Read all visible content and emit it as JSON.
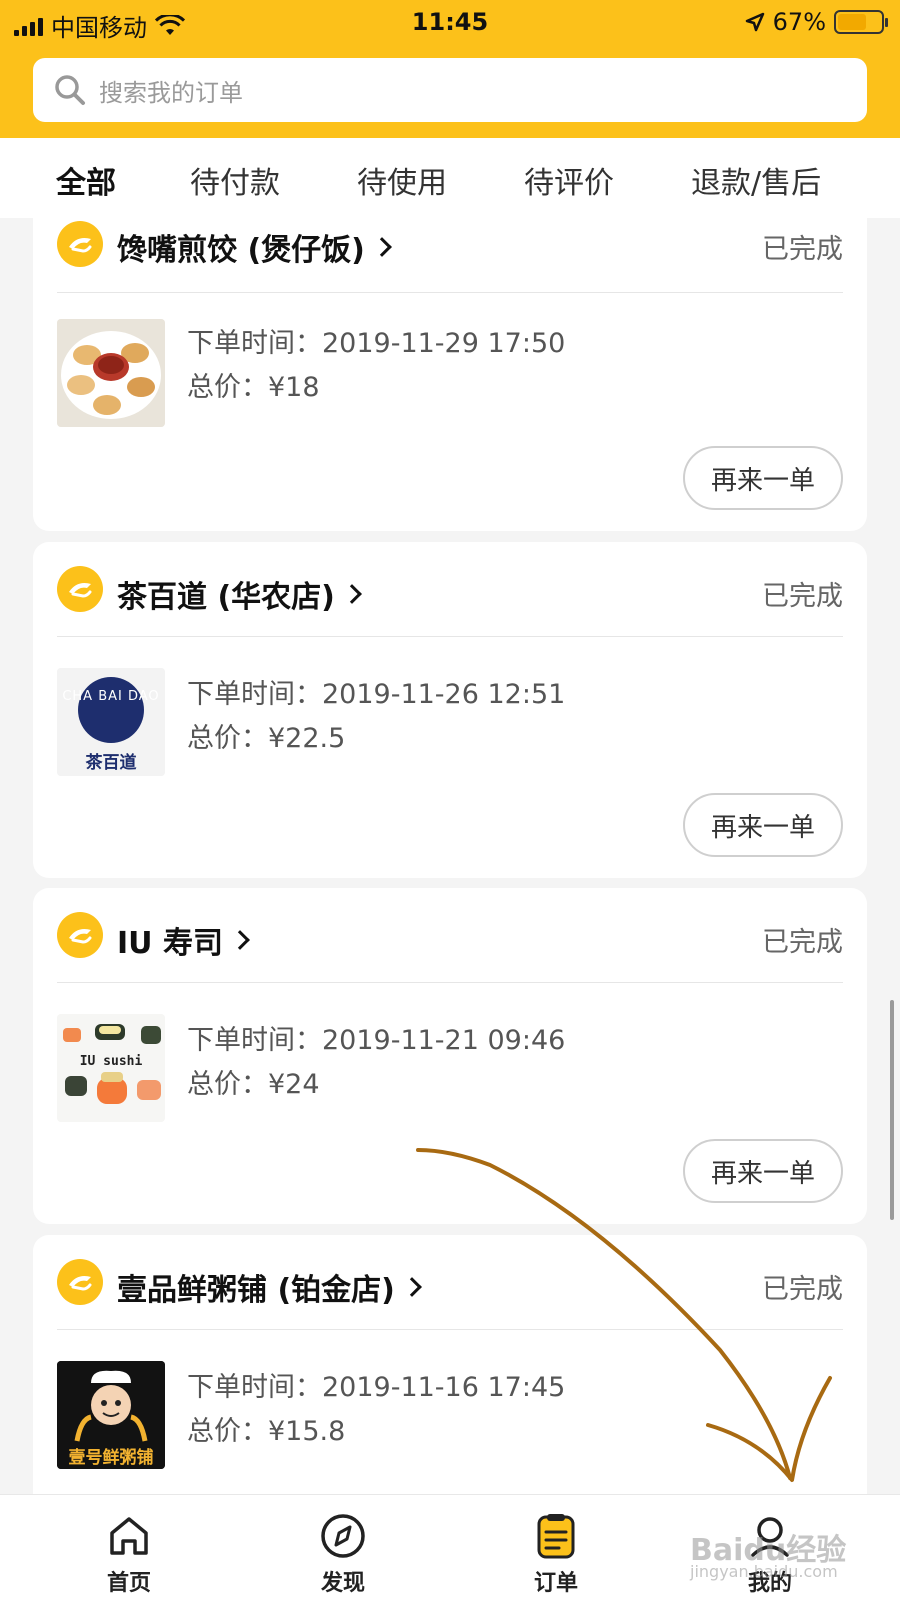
{
  "status_bar": {
    "carrier": "中国移动",
    "time": "11:45",
    "battery": "67%",
    "battery_level": 0.67
  },
  "search": {
    "placeholder": "搜索我的订单"
  },
  "tabs": [
    {
      "label": "全部",
      "active": true
    },
    {
      "label": "待付款",
      "active": false
    },
    {
      "label": "待使用",
      "active": false
    },
    {
      "label": "待评价",
      "active": false
    },
    {
      "label": "退款/售后",
      "active": false
    }
  ],
  "orders": [
    {
      "shop": "馋嘴煎饺 (煲仔饭)",
      "status": "已完成",
      "time_label": "下单时间：",
      "time": "2019-11-29 17:50",
      "price_label": "总价：",
      "price": "¥18",
      "action": "再来一单",
      "thumb_text": ""
    },
    {
      "shop": "茶百道 (华农店)",
      "status": "已完成",
      "time_label": "下单时间：",
      "time": "2019-11-26 12:51",
      "price_label": "总价：",
      "price": "¥22.5",
      "action": "再来一单",
      "thumb_text": "CHA BAI DAO",
      "thumb_sub": "茶百道"
    },
    {
      "shop": "IU 寿司",
      "status": "已完成",
      "time_label": "下单时间：",
      "time": "2019-11-21 09:46",
      "price_label": "总价：",
      "price": "¥24",
      "action": "再来一单",
      "thumb_text": "IU sushi"
    },
    {
      "shop": "壹品鲜粥铺 (铂金店)",
      "status": "已完成",
      "time_label": "下单时间：",
      "time": "2019-11-16 17:45",
      "price_label": "总价：",
      "price": "¥15.8",
      "action": "",
      "thumb_text": "壹号鲜粥铺"
    }
  ],
  "bottom_nav": [
    {
      "label": "首页",
      "icon": "home-icon",
      "active": false
    },
    {
      "label": "发现",
      "icon": "compass-icon",
      "active": false
    },
    {
      "label": "订单",
      "icon": "order-icon",
      "active": true
    },
    {
      "label": "我的",
      "icon": "user-icon",
      "active": false
    }
  ],
  "watermark": {
    "text": "Baidu经验",
    "sub": "jingyan.baidu.com"
  },
  "colors": {
    "accent": "#fcc11a",
    "annotation_arrow": "#a86a12"
  }
}
